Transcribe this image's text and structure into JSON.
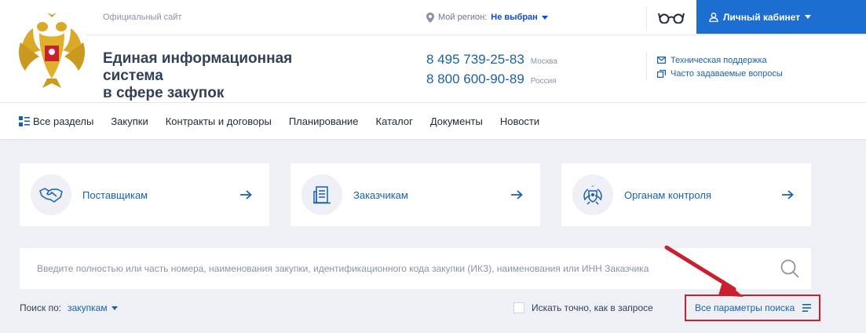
{
  "header": {
    "official_label": "Официальный сайт",
    "site_title_line1": "Единая информационная система",
    "site_title_line2": "в сфере закупок",
    "region_label": "Мой регион:",
    "region_value": "Не выбран",
    "cabinet_label": "Личный кабинет",
    "phones": [
      {
        "number": "8 495 739-25-83",
        "city": "Москва"
      },
      {
        "number": "8 800 600-90-89",
        "city": "Россия"
      }
    ],
    "support_label": "Техническая поддержка",
    "faq_label": "Часто задаваемые вопросы"
  },
  "nav": {
    "all_sections": "Все разделы",
    "items": [
      "Закупки",
      "Контракты и договоры",
      "Планирование",
      "Каталог",
      "Документы",
      "Новости"
    ]
  },
  "cards": [
    {
      "label": "Поставщикам",
      "icon": "handshake-icon"
    },
    {
      "label": "Заказчикам",
      "icon": "building-icon"
    },
    {
      "label": "Органам контроля",
      "icon": "emblem-icon"
    }
  ],
  "search": {
    "placeholder": "Введите полностью или часть номера, наименования закупки, идентификационного кода закупки (ИКЗ), наименования или ИНН Заказчика",
    "search_by_label": "Поиск по:",
    "search_by_value": "закупкам",
    "exact_label": "Искать точно, как в запросе",
    "all_params_label": "Все параметры поиска"
  },
  "colors": {
    "accent": "#1961ac",
    "cabinet_bg": "#1c6fd1",
    "background_gray": "#eef0f5",
    "highlight_red": "#c8202d"
  }
}
